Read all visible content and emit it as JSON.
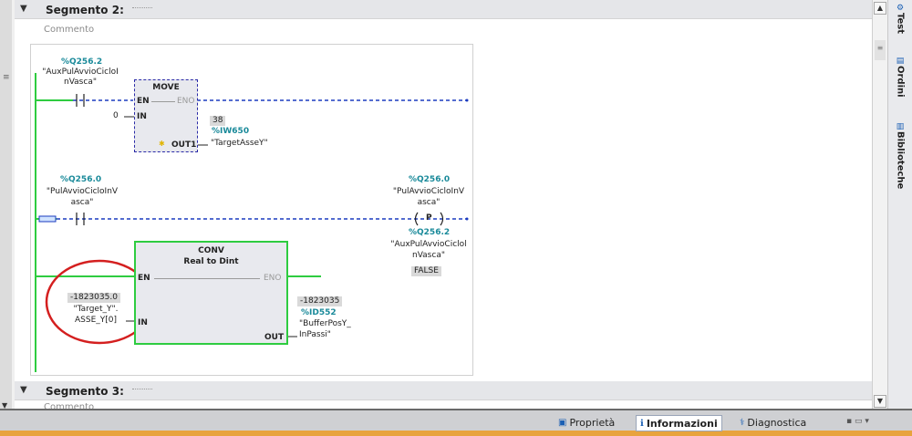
{
  "segment2": {
    "header": "Segmento 2:",
    "comment": "Commento"
  },
  "segment3": {
    "header": "Segmento 3:",
    "comment": "Commento"
  },
  "network": {
    "contact1": {
      "address": "%Q256.2",
      "symbol_line1": "\"AuxPulAvvioCicloI",
      "symbol_line2": "nVasca\""
    },
    "move": {
      "title": "MOVE",
      "en": "EN",
      "eno": "ENO",
      "in": "IN",
      "out": "OUT1",
      "in_value": "0",
      "out_value": "38",
      "out_address": "%IW650",
      "out_symbol": "\"TargetAsseY\""
    },
    "contact2": {
      "address": "%Q256.0",
      "symbol_line1": "\"PulAvvioCicloInV",
      "symbol_line2": "asca\""
    },
    "coil": {
      "address": "%Q256.0",
      "symbol_line1": "\"PulAvvioCicloInV",
      "symbol_line2": "asca\"",
      "label": "P",
      "aux_address": "%Q256.2",
      "aux_line1": "\"AuxPulAvvioCiclol",
      "aux_line2": "nVasca\"",
      "state": "FALSE"
    },
    "conv": {
      "title": "CONV",
      "subtitle": "Real  to  Dint",
      "en": "EN",
      "eno": "ENO",
      "in": "IN",
      "out": "OUT",
      "in_value": "-1823035.0",
      "in_symbol_line1": "\"Target_Y\".",
      "in_symbol_line2": "ASSE_Y[0]",
      "out_value": "-1823035",
      "out_address": "%ID552",
      "out_symbol_line1": "\"BufferPosY_",
      "out_symbol_line2": "InPassi\""
    }
  },
  "sidebar": {
    "tabs": [
      {
        "label": "Test"
      },
      {
        "label": "Ordini"
      },
      {
        "label": "Biblioteche"
      }
    ]
  },
  "bottom": {
    "tabs": [
      {
        "label": "Proprietà",
        "icon": "properties-icon"
      },
      {
        "label": "Informazioni",
        "icon": "info-icon",
        "active": true
      },
      {
        "label": "Diagnostica",
        "icon": "diagnostics-icon"
      }
    ]
  },
  "colors": {
    "address": "#1a8a9a",
    "powerflow": "#2ecc40",
    "dashed_wire": "#1b3bbf",
    "selection": "#2a2aa8"
  }
}
